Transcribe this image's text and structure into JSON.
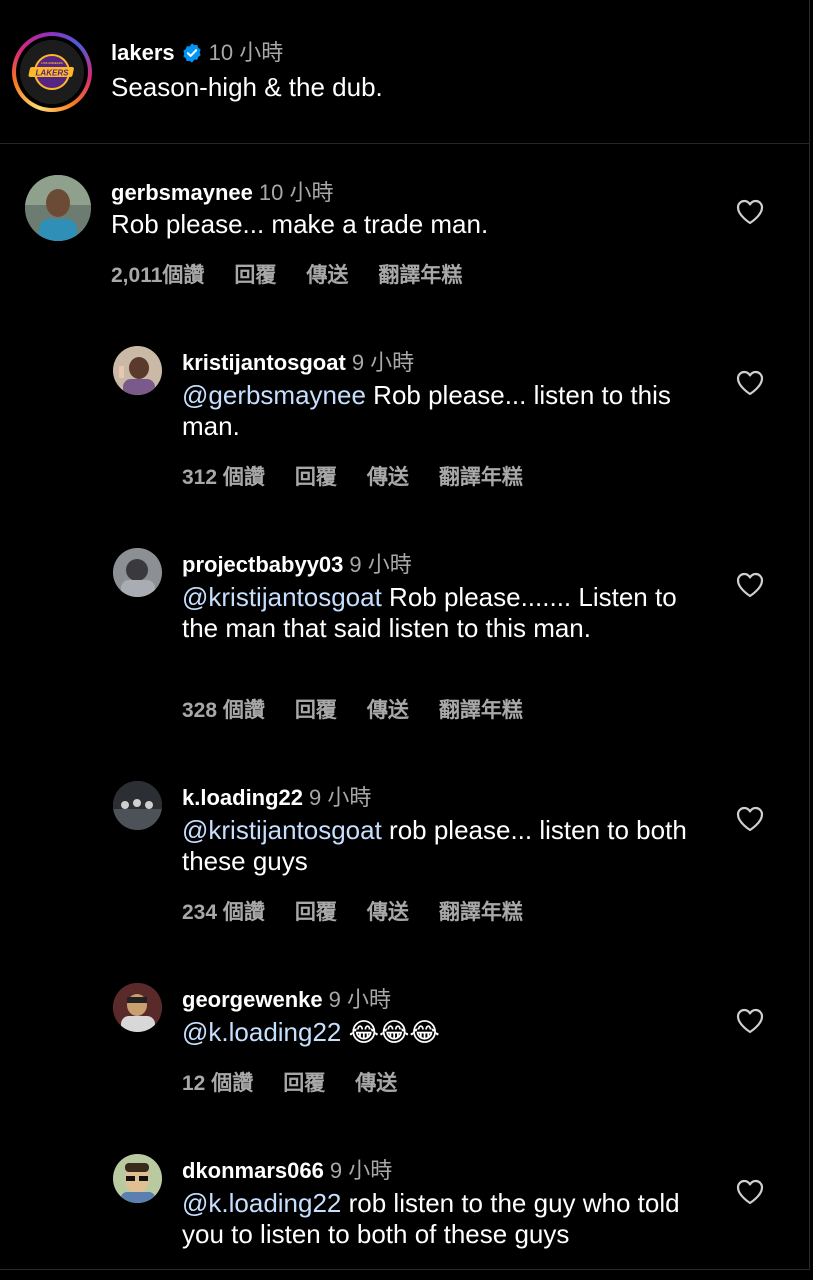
{
  "post": {
    "username": "lakers",
    "time": "10 小時",
    "caption": "Season-high & the dub.",
    "avatar_colors": {
      "purple": "#552583",
      "gold": "#FDB927"
    }
  },
  "comments": [
    {
      "username": "gerbsmaynee",
      "time": "10 小時",
      "mention": "",
      "text": "Rob please... make a trade man.",
      "likes": "2,011個讚",
      "reply": "回覆",
      "send": "傳送",
      "translate": "翻譯年糕"
    },
    {
      "username": "kristijantosgoat",
      "time": "9 小時",
      "mention": "@gerbsmaynee",
      "text": " Rob please... listen to this man.",
      "likes": "312 個讚",
      "reply": "回覆",
      "send": "傳送",
      "translate": "翻譯年糕"
    },
    {
      "username": "projectbabyy03",
      "time": "9 小時",
      "mention": "@kristijantosgoat",
      "text": " Rob please....... Listen to the man that said listen to this man.",
      "likes": "328 個讚",
      "reply": "回覆",
      "send": "傳送",
      "translate": "翻譯年糕"
    },
    {
      "username": "k.loading22",
      "time": "9 小時",
      "mention": "@kristijantosgoat",
      "text": " rob please... listen to both these guys",
      "likes": "234 個讚",
      "reply": "回覆",
      "send": "傳送",
      "translate": "翻譯年糕"
    },
    {
      "username": "georgewenke",
      "time": "9 小時",
      "mention": "@k.loading22",
      "text": " 😂😂😂",
      "likes": "12 個讚",
      "reply": "回覆",
      "send": "傳送"
    },
    {
      "username": "dkonmars066",
      "time": "9 小時",
      "mention": "@k.loading22",
      "text": " rob listen to the guy who told you to listen to both of these guys"
    }
  ],
  "icons": {
    "verified": "verified-badge-icon",
    "heart": "heart-outline-icon"
  },
  "colors": {
    "background": "#000000",
    "secondary_text": "#a8a8a8",
    "verified_blue": "#0095f6"
  }
}
